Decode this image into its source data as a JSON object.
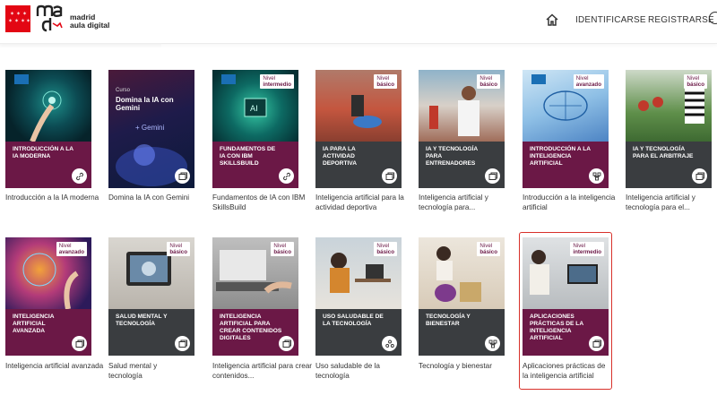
{
  "header": {
    "brand_line1": "madrid",
    "brand_line2": "aula digital",
    "nav": [
      "IDENTIFICARSE",
      "REGISTRARSE"
    ]
  },
  "courses": [
    {
      "title": "INTRODUCCIÓN A LA IA MODERNA",
      "level": "",
      "caption": "Introducción a la IA moderna",
      "icon": "link-icon"
    },
    {
      "title": "",
      "level": "",
      "caption": "Domina la IA con Gemini",
      "icon": "course-icon",
      "cover_line1": "Curso",
      "cover_line2": "Domina la IA con Gemini",
      "cover_brand": "+ Gemini"
    },
    {
      "title": "FUNDAMENTOS DE IA CON IBM SKILLSBUILD",
      "level": "Nivel intermedio",
      "caption": "Fundamentos de IA con IBM SkillsBuild",
      "icon": "link-icon"
    },
    {
      "title": "IA PARA LA ACTIVIDAD DEPORTIVA",
      "level": "Nivel básico",
      "caption": "Inteligencia artificial para la actividad deportiva",
      "icon": "course-icon"
    },
    {
      "title": "IA Y TECNOLOGÍA PARA ENTRENADORES",
      "level": "Nivel básico",
      "caption": "Inteligencia artificial y tecnología para...",
      "icon": "course-icon"
    },
    {
      "title": "INTRODUCCIÓN A LA INTELIGENCIA ARTIFICIAL",
      "level": "Nivel avanzado",
      "caption": "Introducción a la inteligencia artificial",
      "icon": "path-icon"
    },
    {
      "title": "IA Y TECNOLOGÍA PARA EL ARBITRAJE",
      "level": "Nivel básico",
      "caption": "Inteligencia artificial y tecnología para el...",
      "icon": "course-icon"
    },
    {
      "title": "INTELIGENCIA ARTIFICIAL AVANZADA",
      "level": "Nivel avanzado",
      "caption": "Inteligencia artificial avanzada",
      "icon": "course-icon"
    },
    {
      "title": "SALUD MENTAL Y TECNOLOGÍA",
      "level": "Nivel básico",
      "caption": "Salud mental y tecnología",
      "icon": "course-icon"
    },
    {
      "title": "INTELIGENCIA ARTIFICIAL PARA CREAR CONTENIDOS DIGITALES",
      "level": "Nivel básico",
      "caption": "Inteligencia artificial para crear contenidos...",
      "icon": "course-icon"
    },
    {
      "title": "USO SALUDABLE DE LA TECNOLOGÍA",
      "level": "Nivel básico",
      "caption": "Uso saludable de la tecnología",
      "icon": "group-icon"
    },
    {
      "title": "TECNOLOGÍA Y BIENESTAR",
      "level": "Nivel básico",
      "caption": "Tecnología y bienestar",
      "icon": "path-icon"
    },
    {
      "title": "APLICACIONES PRÁCTICAS DE LA INTELIGENCIA ARTIFICIAL",
      "level": "Nivel intermedio",
      "caption": "Aplicaciones prácticas de la inteligencia artificial",
      "icon": "course-icon"
    }
  ],
  "colors": {
    "brand_red": "#e30613",
    "band_purple": "#6b1846",
    "band_dark": "#3a3d40",
    "highlight": "#d8312a"
  }
}
